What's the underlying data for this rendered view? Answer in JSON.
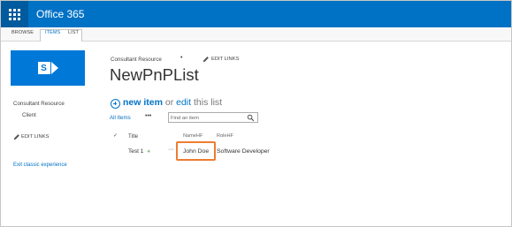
{
  "suite_bar": {
    "app_name": "Office 365",
    "color": "#0072c6"
  },
  "ribbon": {
    "tabs": [
      "BROWSE",
      "ITEMS",
      "LIST"
    ]
  },
  "left_nav": {
    "site_link": "Consultant Resource",
    "client_link": "Client",
    "edit_links": "EDIT LINKS",
    "exit_link": "Exit classic experience"
  },
  "header": {
    "breadcrumb": "Consultant Resource",
    "edit_links": "EDIT LINKS",
    "page_title": "NewPnPList"
  },
  "new_item_line": {
    "new_item": "new item",
    "or": "or",
    "edit": "edit",
    "this_list": "this list"
  },
  "view_bar": {
    "view_name": "All Items",
    "ellipsis": "•••",
    "search_placeholder": "Find an item"
  },
  "table": {
    "check_glyph": "✓",
    "columns": [
      "Title",
      "NameHF",
      "RoleHF"
    ],
    "rows": [
      {
        "title": "Test 1",
        "new_marker": "✳",
        "ellipsis": "···",
        "namehf": "John Doe",
        "rolehf": "Software Developer"
      }
    ]
  },
  "highlight_color": "#ed7d31"
}
